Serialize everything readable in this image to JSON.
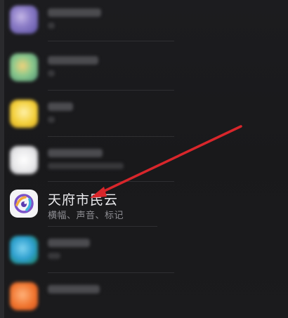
{
  "app_list": {
    "focused_app": {
      "name": "天府市民云",
      "notification_types": "横幅、声音、标记",
      "icon": "tianfu-citizen-cloud-app-icon"
    },
    "blurred_app_icons": [
      "purple-app-icon",
      "green-app-icon",
      "yellow-app-icon",
      "white-app-icon",
      "teal-app-icon",
      "orange-app-icon"
    ]
  },
  "annotation": {
    "arrow_color": "#d8262b",
    "icon": "red-pointer-arrow"
  },
  "colors": {
    "background": "#1a1a1c",
    "primary_text": "#e9e9ec",
    "secondary_text": "#8e8e93"
  }
}
